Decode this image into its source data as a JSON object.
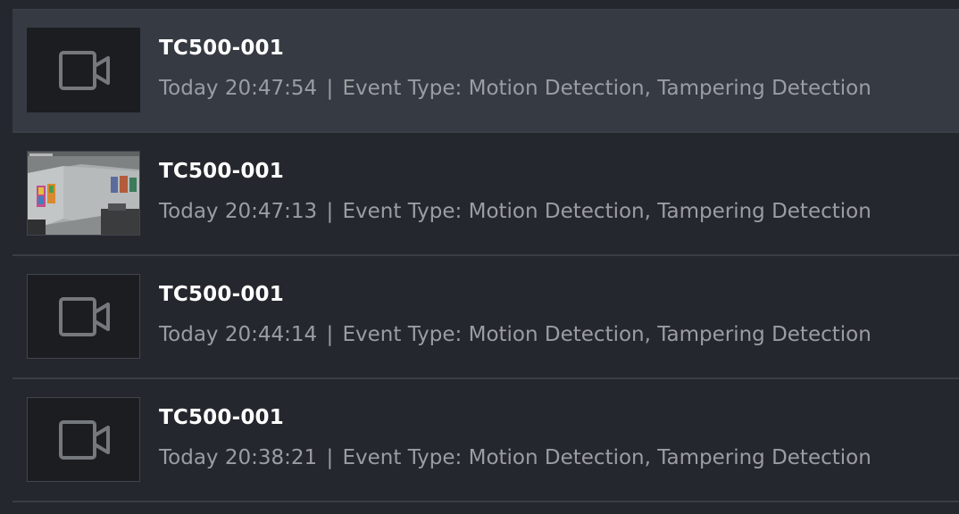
{
  "events": [
    {
      "camera_name": "TC500-001",
      "time": "Today 20:47:54",
      "separator": "|",
      "event_type": "Event Type: Motion Detection, Tampering Detection",
      "thumbnail": "camera-icon",
      "selected": true
    },
    {
      "camera_name": "TC500-001",
      "time": "Today 20:47:13",
      "separator": "|",
      "event_type": "Event Type: Motion Detection, Tampering Detection",
      "thumbnail": "snapshot-image",
      "selected": false
    },
    {
      "camera_name": "TC500-001",
      "time": "Today 20:44:14",
      "separator": "|",
      "event_type": "Event Type: Motion Detection, Tampering Detection",
      "thumbnail": "camera-icon",
      "selected": false
    },
    {
      "camera_name": "TC500-001",
      "time": "Today 20:38:21",
      "separator": "|",
      "event_type": "Event Type: Motion Detection, Tampering Detection",
      "thumbnail": "camera-icon",
      "selected": false
    }
  ],
  "colors": {
    "background": "#24272d",
    "selected_row": "#363a42",
    "title_text": "#ffffff",
    "detail_text": "#9a9da2",
    "icon_stroke": "#75787d"
  }
}
